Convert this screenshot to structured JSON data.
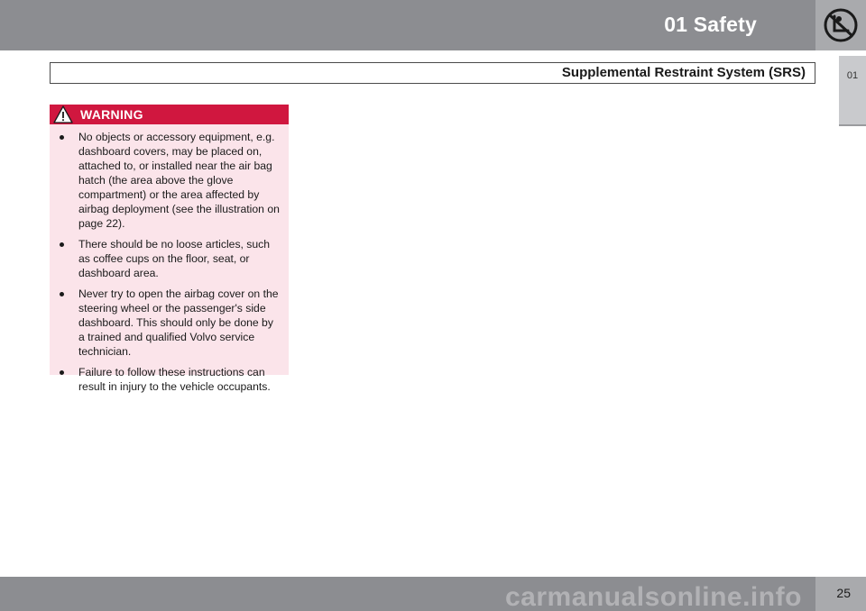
{
  "header": {
    "chapter_title": "01 Safety",
    "section_title": "Supplemental Restraint System (SRS)",
    "chapter_icon": "seat-airbag-icon"
  },
  "side_tab": {
    "label": "01"
  },
  "warning": {
    "title": "WARNING",
    "icon": "warning-triangle-icon",
    "items": [
      "No objects or accessory equipment, e.g. dashboard covers, may be placed on, attached to, or installed near the air bag hatch (the area above the glove compartment) or the area affected by airbag deployment (see the illustration on page 22).",
      "There should be no loose articles, such as coffee cups on the floor, seat, or dashboard area.",
      "Never try to open the airbag cover on the steering wheel or the passenger's side dashboard. This should only be done by a trained and qualified Volvo service technician.",
      "Failure to follow these instructions can result in injury to the vehicle occupants."
    ]
  },
  "footer": {
    "page_number": "25",
    "watermark": "carmanualsonline.info"
  },
  "colors": {
    "band_gray": "#8c8d91",
    "warning_red": "#d0173f",
    "warning_bg": "#fbe4ea"
  }
}
